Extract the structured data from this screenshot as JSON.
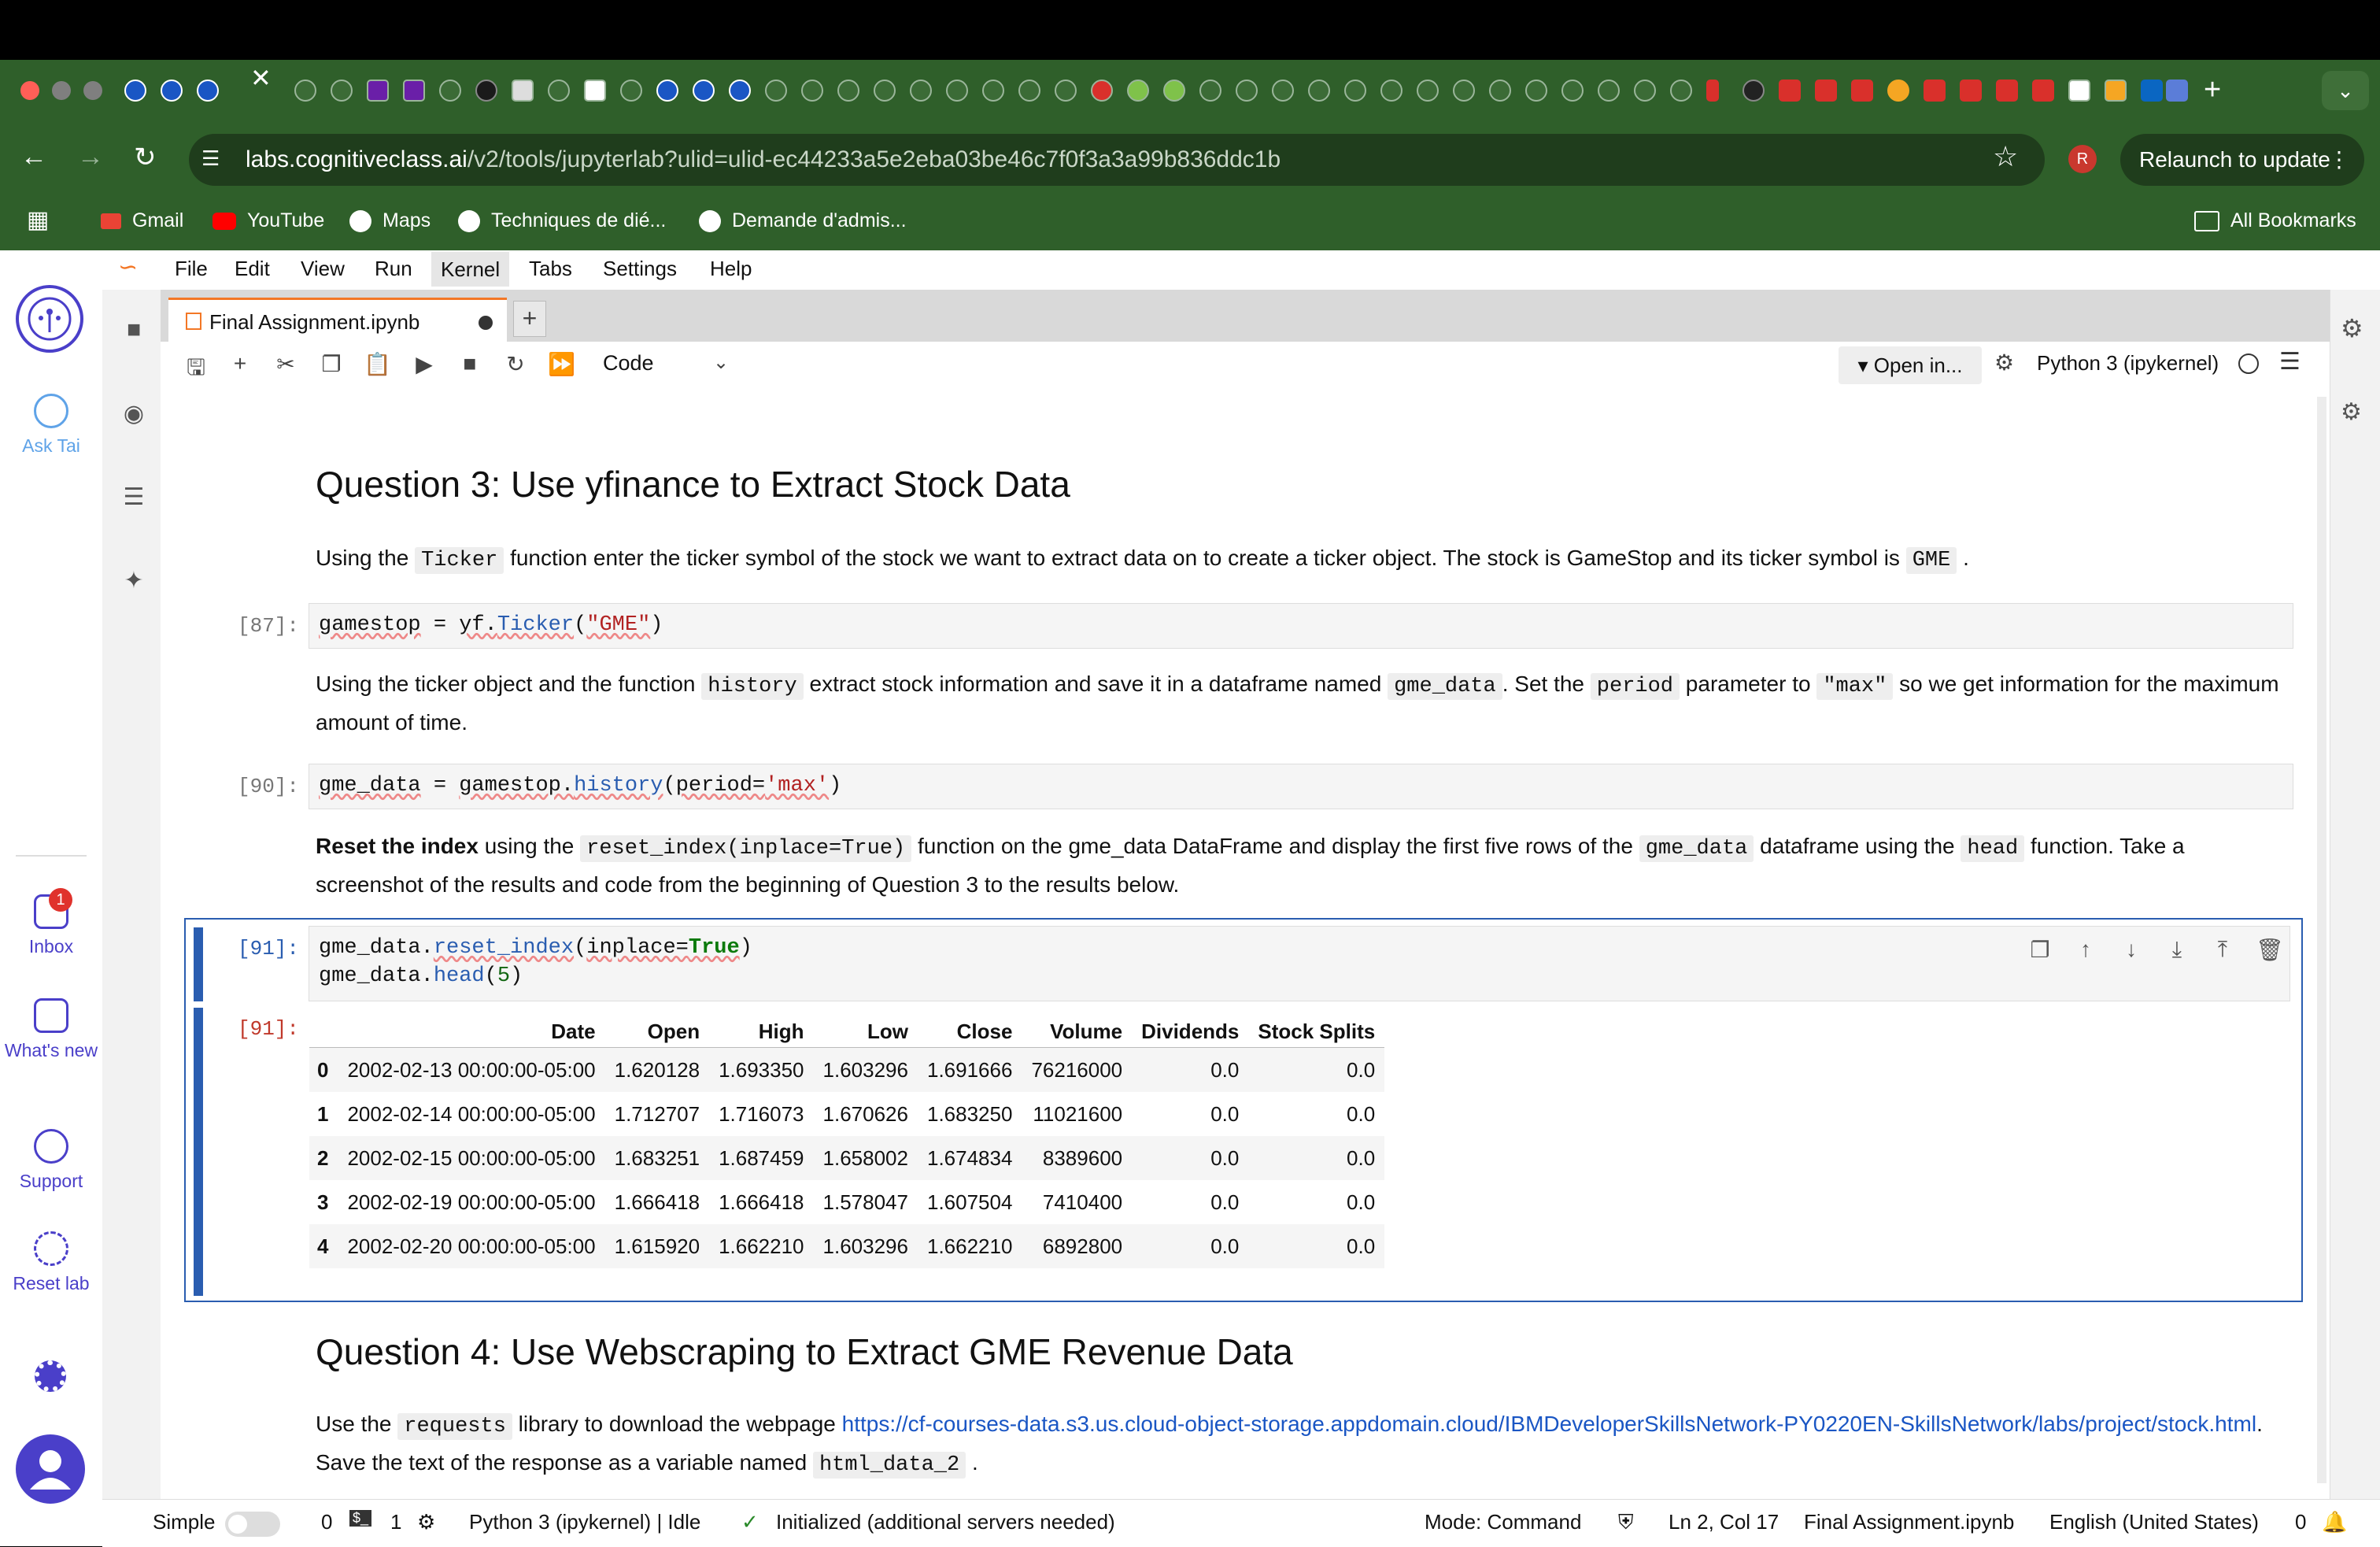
{
  "browser": {
    "active_tab_close": "✕",
    "new_tab": "+",
    "tab_menu": "⌄",
    "url_domain": "labs.cognitiveclass.ai",
    "url_path": "/v2/tools/jupyterlab?ulid=ulid-ec44233a5e2eba03be46c7f0f3a3a99b836ddc1b",
    "profile_initial": "R",
    "relaunch_label": "Relaunch to update",
    "bookmarks": [
      "Gmail",
      "YouTube",
      "Maps",
      "Techniques de dié...",
      "Demande d'admis..."
    ],
    "all_bookmarks": "All Bookmarks"
  },
  "labs_sidebar": {
    "ask_tai": "Ask Tai",
    "inbox": "Inbox",
    "inbox_badge": "1",
    "whats_new": "What's new",
    "support": "Support",
    "reset_lab": "Reset lab"
  },
  "menu": [
    "File",
    "Edit",
    "View",
    "Run",
    "Kernel",
    "Tabs",
    "Settings",
    "Help"
  ],
  "doc_tab": {
    "title": "Final Assignment.ipynb",
    "plus": "+"
  },
  "nb_toolbar": {
    "cell_type": "Code",
    "open_in": "Open in...",
    "kernel": "Python 3 (ipykernel)"
  },
  "notebook": {
    "q3_heading": "Question 3: Use yfinance to Extract Stock Data",
    "q3_p1": {
      "a": "Using the ",
      "code1": "Ticker",
      "b": " function enter the ticker symbol of the stock we want to extract data on to create a ticker object. The stock is GameStop and its ticker symbol is ",
      "code2": "GME",
      "c": " ."
    },
    "cell87_prompt": "[87]:",
    "cell87_code": {
      "var": "gamestop",
      "eq": " = ",
      "mod": "yf.",
      "fn": "Ticker",
      "arg": "\"GME\""
    },
    "q3_p2": {
      "a": "Using the ticker object and the function ",
      "code1": "history",
      "b": " extract stock information and save it in a dataframe named ",
      "code2": "gme_data",
      "c": ". Set the ",
      "code3": "period",
      "d": " parameter to ",
      "code4": "\"max\"",
      "e": " so we get information for the maximum amount of time."
    },
    "cell90_prompt": "[90]:",
    "cell90_code": {
      "var": "gme_data",
      "eq": " = ",
      "obj": "gamestop.",
      "fn": "history",
      "kw": "period=",
      "arg": "'max'"
    },
    "q3_p3": {
      "bold": "Reset the index",
      "a": " using the ",
      "code1": "reset_index(inplace=True)",
      "b": " function on the gme_data DataFrame and display the first five rows of the ",
      "code2": "gme_data",
      "c": " dataframe using the ",
      "code3": "head",
      "d": " function. Take a screenshot of the results and code from the beginning of Question 3 to the results below."
    },
    "cell91_prompt": "[91]:",
    "cell91_line1": {
      "obj": "gme_data.",
      "fn": "reset_index",
      "kw": "inplace=",
      "val": "True"
    },
    "cell91_line2": {
      "obj": "gme_data.",
      "fn": "head",
      "num": "5"
    },
    "out91_prompt": "[91]:",
    "table": {
      "columns": [
        "",
        "Date",
        "Open",
        "High",
        "Low",
        "Close",
        "Volume",
        "Dividends",
        "Stock Splits"
      ],
      "rows": [
        [
          "0",
          "2002-02-13 00:00:00-05:00",
          "1.620128",
          "1.693350",
          "1.603296",
          "1.691666",
          "76216000",
          "0.0",
          "0.0"
        ],
        [
          "1",
          "2002-02-14 00:00:00-05:00",
          "1.712707",
          "1.716073",
          "1.670626",
          "1.683250",
          "11021600",
          "0.0",
          "0.0"
        ],
        [
          "2",
          "2002-02-15 00:00:00-05:00",
          "1.683251",
          "1.687459",
          "1.658002",
          "1.674834",
          "8389600",
          "0.0",
          "0.0"
        ],
        [
          "3",
          "2002-02-19 00:00:00-05:00",
          "1.666418",
          "1.666418",
          "1.578047",
          "1.607504",
          "7410400",
          "0.0",
          "0.0"
        ],
        [
          "4",
          "2002-02-20 00:00:00-05:00",
          "1.615920",
          "1.662210",
          "1.603296",
          "1.662210",
          "6892800",
          "0.0",
          "0.0"
        ]
      ]
    },
    "q4_heading": "Question 4: Use Webscraping to Extract GME Revenue Data",
    "q4_p1": {
      "a": "Use the ",
      "code1": "requests",
      "b": " library to download the webpage ",
      "link": "https://cf-courses-data.s3.us.cloud-object-storage.appdomain.cloud/IBMDeveloperSkillsNetwork-PY0220EN-SkillsNetwork/labs/project/stock.html",
      "c": ". Save the text of the response as a variable named ",
      "code2": "html_data_2",
      "d": " ."
    }
  },
  "statusbar": {
    "simple": "Simple",
    "terminals": "0",
    "kernels": "1",
    "kernel_status": "Python 3 (ipykernel) | Idle",
    "init_status": "Initialized (additional servers needed)",
    "mode": "Mode: Command",
    "position": "Ln 2, Col 17",
    "filename": "Final Assignment.ipynb",
    "language": "English (United States)",
    "notifications": "0"
  },
  "colors": {
    "chrome": "#2f5f2a",
    "accent": "#2a5db0",
    "labs": "#4a3fc9",
    "jupyter_orange": "#f37726"
  }
}
